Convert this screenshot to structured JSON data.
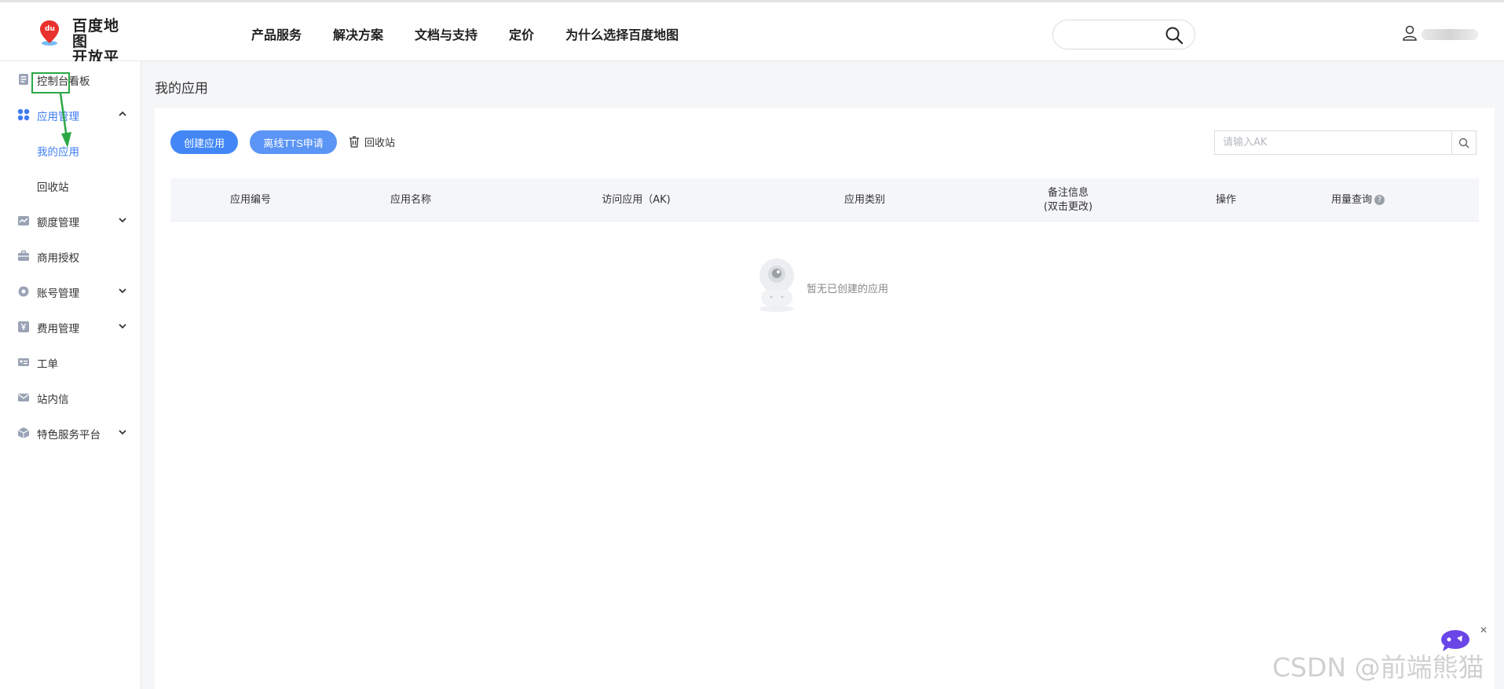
{
  "logo": {
    "line1": "百度地图",
    "line2": "开放平台",
    "badge": "du"
  },
  "nav": [
    "产品服务",
    "解决方案",
    "文档与支持",
    "定价",
    "为什么选择百度地图"
  ],
  "sidebar": {
    "items": [
      {
        "label": "控制台看板",
        "icon": "dashboard-icon"
      },
      {
        "label": "应用管理",
        "icon": "apps-icon",
        "expanded": true
      },
      {
        "label": "我的应用",
        "sub": true,
        "active": true
      },
      {
        "label": "回收站",
        "sub": true
      },
      {
        "label": "额度管理",
        "icon": "quota-icon"
      },
      {
        "label": "商用授权",
        "icon": "briefcase-icon"
      },
      {
        "label": "账号管理",
        "icon": "gear-icon"
      },
      {
        "label": "费用管理",
        "icon": "yen-icon"
      },
      {
        "label": "工单",
        "icon": "ticket-icon"
      },
      {
        "label": "站内信",
        "icon": "mail-icon"
      },
      {
        "label": "特色服务平台",
        "icon": "cube-icon"
      }
    ]
  },
  "main": {
    "title": "我的应用",
    "create_label": "创建应用",
    "tts_label": "离线TTS申请",
    "trash_label": "回收站",
    "search_placeholder": "请输入AK",
    "columns": [
      "应用编号",
      "应用名称",
      "访问应用（AK)",
      "应用类别",
      "备注信息",
      "(双击更改)",
      "操作",
      "用量查询"
    ],
    "empty_text": "暂无已创建的应用"
  },
  "watermark": "CSDN @前端熊猫",
  "colors": {
    "accent": "#4287f5",
    "highlight": "#2aa845"
  }
}
